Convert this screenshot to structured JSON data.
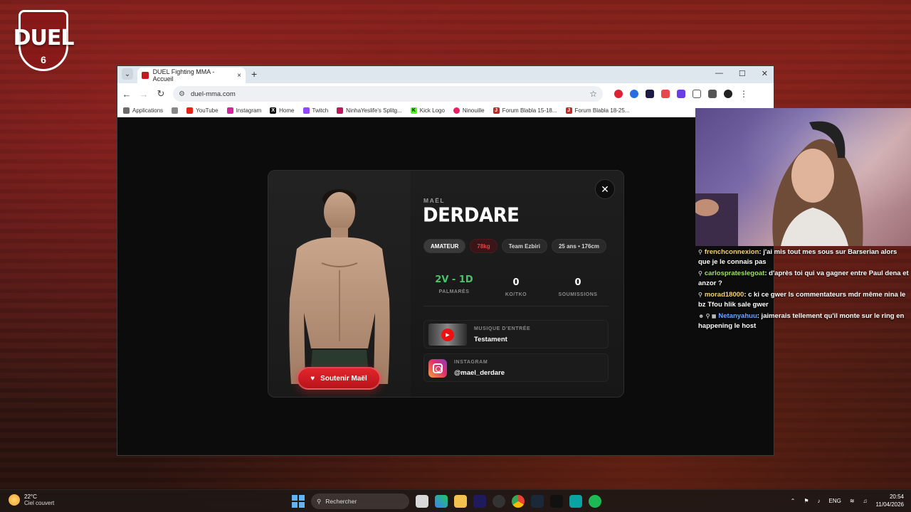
{
  "overlay": {
    "logo_word": "DUEL",
    "logo_number": "6"
  },
  "browser": {
    "tab_title": "DUEL Fighting MMA - Accueil",
    "tab_close": "×",
    "new_tab": "+",
    "url": "duel-mma.com",
    "bookmarks": [
      {
        "label": "Applications",
        "color": "#6b6b6b"
      },
      {
        "label": "YouTube",
        "color": "#e62117"
      },
      {
        "label": "Instagram",
        "color": "#d6249f"
      },
      {
        "label": "Home",
        "color": "#111111"
      },
      {
        "label": "Twitch",
        "color": "#9146ff"
      },
      {
        "label": "NinhaYeslife's Splitg...",
        "color": "#c2185b"
      },
      {
        "label": "Kick Logo",
        "color": "#53fc18"
      },
      {
        "label": "Ninouille",
        "color": "#e91e63"
      },
      {
        "label": "Forum Blabla 15-18...",
        "color": "#c62828"
      },
      {
        "label": "Forum Blabla 18-25...",
        "color": "#c62828"
      }
    ]
  },
  "fighter": {
    "first_name": "MAËL",
    "last_name": "DERDARE",
    "chips": {
      "level": "AMATEUR",
      "weight": "78kg",
      "team": "Team Ezbiri",
      "age_height": "25 ans • 176cm"
    },
    "stats": {
      "record_value": "2V - 1D",
      "record_label": "PALMARÈS",
      "ko_value": "0",
      "ko_label": "KO/TKO",
      "sub_value": "0",
      "sub_label": "SOUMISSIONS"
    },
    "music_caption": "MUSIQUE D'ENTRÉE",
    "music_title": "Testament",
    "instagram_caption": "INSTAGRAM",
    "instagram_handle": "@mael_derdare",
    "support_button": "Soutenir Maël",
    "close": "✕"
  },
  "chat": [
    {
      "badge": "⚲",
      "user": "frenchconnexion",
      "user_color": "#f5d27a",
      "text": ": j'ai mis tout mes sous sur Barserian alors que je le connais pas"
    },
    {
      "badge": "⚲",
      "user": "carlosprateslegoat",
      "user_color": "#9be26a",
      "text": ": d'après toi qui va gagner entre Paul dena et anzor ?"
    },
    {
      "badge": "⚲",
      "user": "morad18000",
      "user_color": "#ffd56b",
      "text": ": c ki ce gwer ls commentateurs mdr même nina le bz Tfou hlik sale gwer"
    },
    {
      "badge": "☻ ⚲ ◼",
      "user": "Netanyahuu",
      "user_color": "#6aa8ff",
      "text": ": jaimerais tellement qu'il monte sur le ring en happening le host"
    }
  ],
  "taskbar": {
    "temperature": "22°C",
    "weather_desc": "Ciel couvert",
    "search_placeholder": "Rechercher",
    "lang": "ENG",
    "time": "20:54",
    "date": "11/04/2026"
  }
}
